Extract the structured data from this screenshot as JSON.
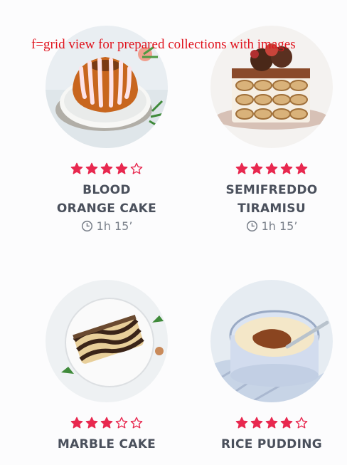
{
  "annotation": "f=grid view for prepared collections with images",
  "colors": {
    "star": "#e8284f",
    "title": "#4a505c",
    "time": "#7a808a"
  },
  "recipes": [
    {
      "title": "BLOOD ORANGE CAKE",
      "rating": 4,
      "max_rating": 5,
      "time": "1h 15’",
      "image": "bundt-cake-image"
    },
    {
      "title": "SEMIFREDDO TIRAMISU",
      "rating": 5,
      "max_rating": 5,
      "time": "1h 15’",
      "image": "tiramisu-image"
    },
    {
      "title": "MARBLE CAKE",
      "rating": 3,
      "max_rating": 5,
      "time": "",
      "image": "marble-cake-image"
    },
    {
      "title": "RICE PUDDING",
      "rating": 4,
      "max_rating": 5,
      "time": "",
      "image": "rice-pudding-image"
    }
  ]
}
